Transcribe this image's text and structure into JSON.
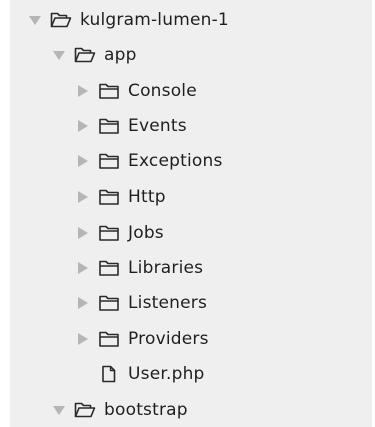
{
  "tree": {
    "root": {
      "label": "kulgram-lumen-1",
      "icon": "folder-open-icon",
      "expanded": true
    },
    "app": {
      "label": "app",
      "icon": "folder-open-icon",
      "expanded": true
    },
    "app_children": [
      {
        "label": "Console",
        "icon": "folder-icon",
        "expanded": false
      },
      {
        "label": "Events",
        "icon": "folder-icon",
        "expanded": false
      },
      {
        "label": "Exceptions",
        "icon": "folder-icon",
        "expanded": false
      },
      {
        "label": "Http",
        "icon": "folder-icon",
        "expanded": false
      },
      {
        "label": "Jobs",
        "icon": "folder-icon",
        "expanded": false
      },
      {
        "label": "Libraries",
        "icon": "folder-icon",
        "expanded": false
      },
      {
        "label": "Listeners",
        "icon": "folder-icon",
        "expanded": false
      },
      {
        "label": "Providers",
        "icon": "folder-icon",
        "expanded": false
      },
      {
        "label": "User.php",
        "icon": "file-icon"
      }
    ],
    "bootstrap": {
      "label": "bootstrap",
      "icon": "folder-open-icon",
      "expanded": true
    }
  },
  "colors": {
    "panel_background": "#efefef",
    "text": "#1f1f1f",
    "icon_stroke": "#2a2a2a",
    "arrow": "#b5b5b5"
  }
}
